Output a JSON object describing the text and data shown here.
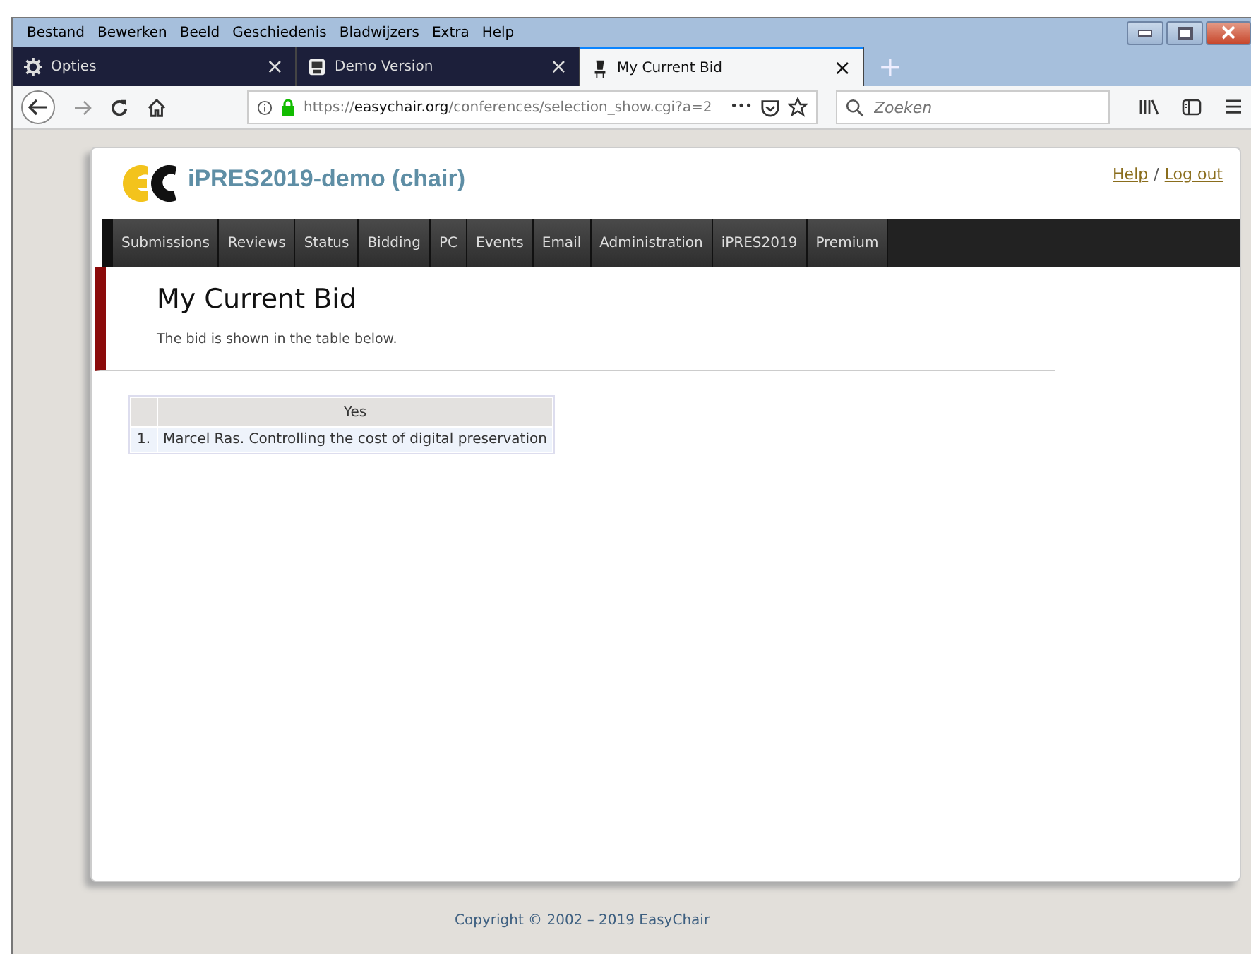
{
  "menu_bar": [
    "Bestand",
    "Bewerken",
    "Beeld",
    "Geschiedenis",
    "Bladwijzers",
    "Extra",
    "Help"
  ],
  "tabs": [
    {
      "label": "Opties",
      "kind": "settings",
      "selected": false,
      "close": "×"
    },
    {
      "label": "Demo Version",
      "kind": "document",
      "selected": false,
      "close": "×"
    },
    {
      "label": "My Current Bid",
      "kind": "site",
      "selected": true,
      "close": "×"
    }
  ],
  "new_tab": "+",
  "address_bar": {
    "url": "https://**easychair.org**/conferences/selection_show.cgi?a=2",
    "more": "•••"
  },
  "search": {
    "placeholder": "Zoeken"
  },
  "page": {
    "logo": "iPRES2019-demo (chair)",
    "links": [
      {
        "label": "Help"
      },
      {
        "label": "Log out"
      }
    ],
    "link_separator": "/",
    "nav": [
      "Submissions",
      "Reviews",
      "Status",
      "Bidding",
      "PC",
      "Events",
      "Email",
      "Administration",
      "iPRES2019",
      "Premium"
    ],
    "heading": "My Current Bid",
    "description": "The bid is shown in the table below.",
    "table": {
      "columns": [
        "Yes"
      ],
      "rows": [
        {
          "number": "1.",
          "paper": "Marcel Ras. Controlling the cost of digital preservation"
        }
      ]
    },
    "footer": "Copyright © 2002 – 2019 EasyChair"
  }
}
